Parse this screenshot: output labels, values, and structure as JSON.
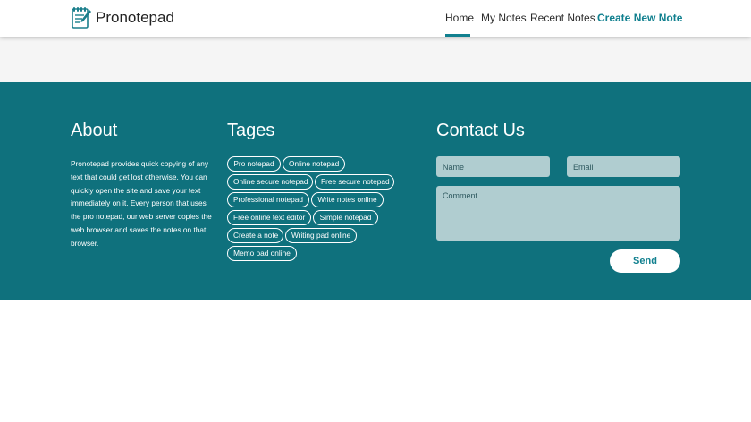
{
  "brand": {
    "name": "Pronotepad",
    "logo_icon": "notepad-pencil-icon"
  },
  "nav": {
    "items": [
      "Home",
      "My Notes",
      "Recent Notes",
      "Create New Note"
    ],
    "active": "Home"
  },
  "footer": {
    "about": {
      "title": "About",
      "text": "Pronotepad provides quick copying of any text that could get lost otherwise. You can quickly open the site and save your text immediately on it. Every person that uses the pro notepad, our web server copies the web browser and saves the notes on that browser."
    },
    "tags": {
      "title": "Tages",
      "items": [
        "Pro notepad",
        "Online notepad",
        "Online secure notepad",
        "Free secure notepad",
        "Professional notepad",
        "Write notes online",
        "Free online text editor",
        "Simple notepad",
        "Create a note",
        "Writing pad online",
        "Memo pad online"
      ]
    },
    "contact": {
      "title": "Contact Us",
      "name_placeholder": "Name",
      "email_placeholder": "Email",
      "comment_placeholder": "Comment",
      "send_label": "Send"
    }
  },
  "colors": {
    "accent": "#11808f",
    "footer_bg": "#0f717d",
    "input_bg": "#b0cdd0",
    "gray_band": "#f5f5f5"
  }
}
